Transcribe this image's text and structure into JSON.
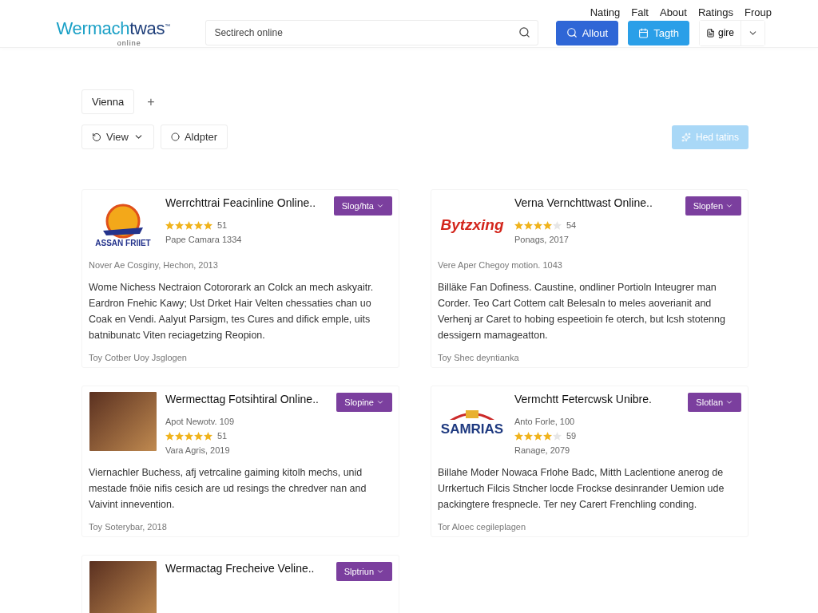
{
  "top_nav": [
    "Nating",
    "Falt",
    "About",
    "Ratings",
    "Froup"
  ],
  "logo": {
    "part_1": "Wermach",
    "part_2": "twas",
    "mark": "™",
    "subtitle": "online"
  },
  "search": {
    "placeholder": "Sectirech online"
  },
  "header_buttons": [
    {
      "kind": "primary",
      "label": "Allout"
    },
    {
      "kind": "secondary",
      "label": "Tagth"
    },
    {
      "kind": "split",
      "label": "gire"
    }
  ],
  "location_tabs": [
    {
      "label": "Vienna",
      "selected": true
    }
  ],
  "add_tab": "+",
  "filters": [
    {
      "kind": "dropdown",
      "label": "View"
    },
    {
      "kind": "plain",
      "label": "Aldpter"
    }
  ],
  "action_button": {
    "label": "Hed tatins",
    "disabled": true
  },
  "cards": [
    {
      "media": {
        "kind": "logo",
        "text": "ASSAN FRIIET"
      },
      "title": "Werrchttrai Feacinline Online..",
      "button": "Slog/hta",
      "lines": [
        {
          "kind": "rating",
          "stars": 5,
          "count": "51"
        },
        {
          "kind": "text",
          "text": "Pape Camara 1334"
        }
      ],
      "meta": "Nover Ae Cosginy, Hechon, 2013",
      "body": "Wome Nichess Nectraion Cotororark an Colck an mech askyaitr. Eardron Fnehic Kawy; Ust Drket Hair Velten chessaties chan uo Coak en Vendi. Aalyut Parsigm, tes Cures and difick emple, uits batnibunatc Viten reciagetzing Reopion.",
      "footer": "Toy Cotber Uoy Jsglogen"
    },
    {
      "media": {
        "kind": "wordmark",
        "text": "Bytzxing"
      },
      "title": "Verna Vernchttwast Online..",
      "button": "Slopfen",
      "lines": [
        {
          "kind": "rating",
          "stars": 4,
          "count": "54"
        },
        {
          "kind": "text",
          "text": "Ponags, 2017"
        }
      ],
      "meta": "Vere Aper Chegoy motion. 1043",
      "body": "Billäke Fan Dofiness. Caustine, ondliner Portioln Inteugrer man Corder. Teo Cart Cottem calt Belesaln to meles aoverianit and Verhenj ar Caret to hobing espeetioin fe oterch, but lcsh stotenng dessigern mamageatton.",
      "footer": "Toy Shec deyntianka"
    },
    {
      "media": {
        "kind": "photo"
      },
      "title": "Wermecttag Fotsihtiral Online..",
      "button": "Slopine",
      "lines": [
        {
          "kind": "text",
          "text": "Apot Newotv. 109"
        },
        {
          "kind": "rating",
          "stars": 5,
          "count": "51"
        },
        {
          "kind": "text",
          "text": "Vara Agris, 2019"
        }
      ],
      "body": "Viernachler Buchess, afj vetrcaline gaiming kitolh mechs, unid mestade fnöie nifis cesich are ud resings the chredver nan and Vaivint innevention.",
      "footer": "Toy Soterybar, 2018"
    },
    {
      "media": {
        "kind": "emblem",
        "text": "SAMRIAS"
      },
      "title": "Vermchtt Fetercwsk Unibre.",
      "button": "Slotlan",
      "lines": [
        {
          "kind": "text",
          "text": "Anto Forle, 100"
        },
        {
          "kind": "rating",
          "stars": 4,
          "count": "59"
        },
        {
          "kind": "text",
          "text": "Ranage, 2079"
        }
      ],
      "body": "Billahe Moder Nowaca Frlohe Badc, Mitth Laclentione anerog de Urrkertuch Filcis Stncher locde Frockse desinrander Uemion ude packingtere frespnecle. Ter ney Carert Frenchling conding.",
      "footer": "Tor Aloec cegileplagen"
    },
    {
      "media": {
        "kind": "photo"
      },
      "title": "Wermactag Frecheive Veline..",
      "button": "Slptriun"
    }
  ]
}
